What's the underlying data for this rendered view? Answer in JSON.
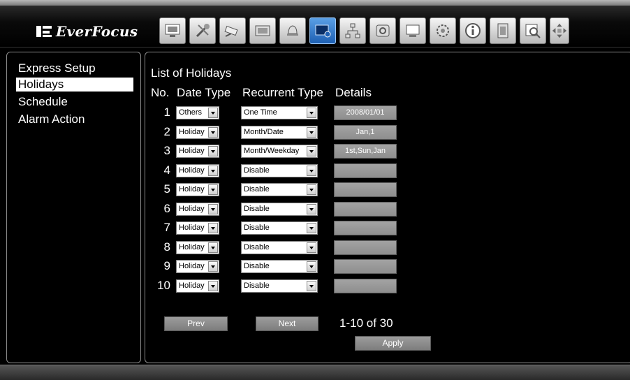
{
  "brand": {
    "name": "EverFocus"
  },
  "toolbar": {
    "items": [
      {
        "icon": "monitor-icon"
      },
      {
        "icon": "tools-icon"
      },
      {
        "icon": "camera-icon"
      },
      {
        "icon": "film-icon"
      },
      {
        "icon": "bell-icon"
      },
      {
        "icon": "display-settings-icon",
        "active": true
      },
      {
        "icon": "network-icon"
      },
      {
        "icon": "disk-icon"
      },
      {
        "icon": "screen-icon"
      },
      {
        "icon": "gear-icon"
      },
      {
        "icon": "info-icon"
      },
      {
        "icon": "playback-icon"
      },
      {
        "icon": "search-icon"
      },
      {
        "icon": "ptz-arrows-icon"
      }
    ]
  },
  "sidebar": {
    "items": [
      {
        "label": "Express Setup"
      },
      {
        "label": "Holidays",
        "selected": true
      },
      {
        "label": "Schedule"
      },
      {
        "label": "Alarm Action"
      }
    ]
  },
  "main": {
    "title": "List of Holidays",
    "columns": {
      "no": "No.",
      "date_type": "Date Type",
      "recurrent_type": "Recurrent Type",
      "details": "Details"
    },
    "rows": [
      {
        "no": "1",
        "date_type": "Others",
        "recurrent_type": "One Time",
        "details": "2008/01/01"
      },
      {
        "no": "2",
        "date_type": "Holiday",
        "recurrent_type": "Month/Date",
        "details": "Jan,1"
      },
      {
        "no": "3",
        "date_type": "Holiday",
        "recurrent_type": "Month/Weekday",
        "details": "1st,Sun,Jan"
      },
      {
        "no": "4",
        "date_type": "Holiday",
        "recurrent_type": "Disable",
        "details": ""
      },
      {
        "no": "5",
        "date_type": "Holiday",
        "recurrent_type": "Disable",
        "details": ""
      },
      {
        "no": "6",
        "date_type": "Holiday",
        "recurrent_type": "Disable",
        "details": ""
      },
      {
        "no": "7",
        "date_type": "Holiday",
        "recurrent_type": "Disable",
        "details": ""
      },
      {
        "no": "8",
        "date_type": "Holiday",
        "recurrent_type": "Disable",
        "details": ""
      },
      {
        "no": "9",
        "date_type": "Holiday",
        "recurrent_type": "Disable",
        "details": ""
      },
      {
        "no": "10",
        "date_type": "Holiday",
        "recurrent_type": "Disable",
        "details": ""
      }
    ],
    "prev_label": "Prev",
    "next_label": "Next",
    "page_info": "1-10 of 30",
    "apply_label": "Apply"
  },
  "colors": {
    "accent": "#1d5fb2",
    "background": "#000000",
    "button": "#8e8e8e"
  }
}
